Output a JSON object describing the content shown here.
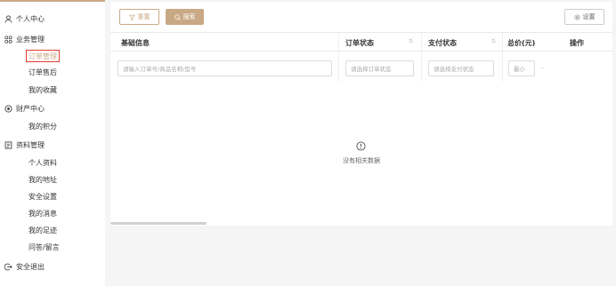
{
  "sidebar": {
    "personal_center": "个人中心",
    "business_mgmt": "业务管理",
    "order_mgmt": "订单管理",
    "after_sales": "订单售后",
    "favorites": "我的收藏",
    "finance_center": "财产中心",
    "points": "我的积分",
    "profile_mgmt": "资料管理",
    "personal_info": "个人资料",
    "address": "我的地址",
    "security": "安全设置",
    "messages": "我的消息",
    "footprint": "我的足迹",
    "qa": "问答/留言",
    "logout": "安全退出"
  },
  "toolbar": {
    "reset_label": "重置",
    "search_label": "搜索",
    "settings_label": "设置"
  },
  "table": {
    "headers": {
      "basic_info": "基础信息",
      "order_status": "订单状态",
      "payment_status": "支付状态",
      "total_price": "总价(元)",
      "actions": "操作"
    },
    "filters": {
      "basic_placeholder": "请输入订单号/商品名称/型号",
      "order_status_placeholder": "请选择订单状态",
      "payment_status_placeholder": "请选择支付状态",
      "min_price_placeholder": "最小",
      "range_separator": "-"
    },
    "empty_text": "没有相关数据"
  },
  "colors": {
    "accent": "#c9a985",
    "active_border": "#e23b2c"
  }
}
